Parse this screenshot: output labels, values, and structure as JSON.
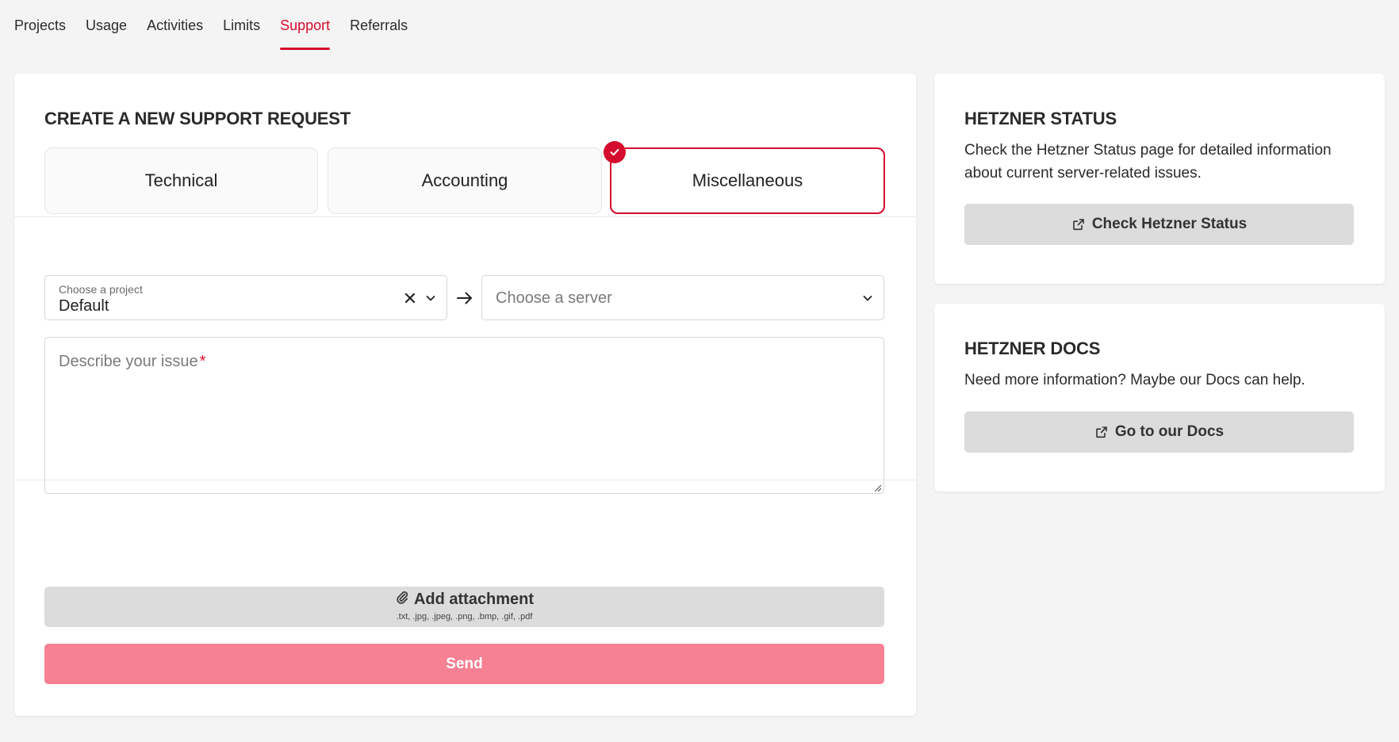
{
  "nav": {
    "tabs": [
      {
        "label": "Projects"
      },
      {
        "label": "Usage"
      },
      {
        "label": "Activities"
      },
      {
        "label": "Limits"
      },
      {
        "label": "Support",
        "active": true
      },
      {
        "label": "Referrals"
      }
    ]
  },
  "support_form": {
    "title": "CREATE A NEW SUPPORT REQUEST",
    "categories": [
      {
        "label": "Technical",
        "selected": false
      },
      {
        "label": "Accounting",
        "selected": false
      },
      {
        "label": "Miscellaneous",
        "selected": true
      }
    ],
    "project_select": {
      "label": "Choose a project",
      "value": "Default"
    },
    "server_select": {
      "placeholder": "Choose a server"
    },
    "issue": {
      "placeholder": "Describe your issue",
      "required_mark": "*"
    },
    "attachment": {
      "label": "Add attachment",
      "hint": ".txt, .jpg, .jpeg, .png, .bmp, .gif, .pdf"
    },
    "send_label": "Send"
  },
  "status_card": {
    "title": "HETZNER STATUS",
    "text": "Check the Hetzner Status page for detailed information about current server-related issues.",
    "button_label": "Check Hetzner Status"
  },
  "docs_card": {
    "title": "HETZNER DOCS",
    "text": "Need more information? Maybe our Docs can help.",
    "button_label": "Go to our Docs"
  },
  "colors": {
    "accent": "#d50c2d",
    "send_button": "#f68193",
    "secondary_button": "#dcdcdc",
    "background": "#f4f4f4"
  },
  "icons": {
    "selected": "check-icon",
    "clear": "close-icon",
    "dropdown": "chevron-down-icon",
    "relation": "arrow-right-icon",
    "attachment": "paperclip-icon",
    "external": "external-link-icon"
  }
}
